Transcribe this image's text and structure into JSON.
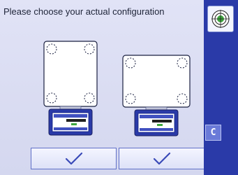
{
  "prompt": {
    "text": "Please choose your actual configuration"
  },
  "sidebar": {
    "level_icon": "level-target-icon",
    "c_label": "C"
  },
  "options": [
    {
      "name": "square-platform",
      "confirm_icon": "checkmark-icon"
    },
    {
      "name": "rectangular-platform",
      "confirm_icon": "checkmark-icon"
    }
  ],
  "colors": {
    "sidebar": "#2a3aa8",
    "background": "#d9dcf2",
    "accent_green": "#3fa63f"
  }
}
